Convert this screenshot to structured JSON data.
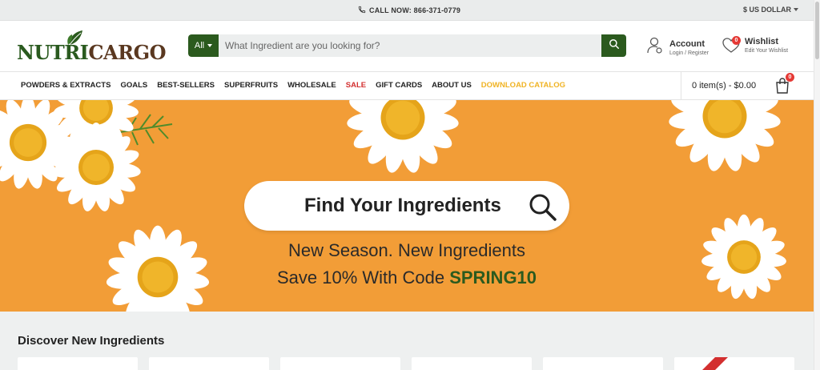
{
  "topbar": {
    "call_label": "CALL NOW: 866-371-0779",
    "currency_label": "$ US DOLLAR"
  },
  "header": {
    "logo_part1": "NUTRI",
    "logo_part2": "CARGO",
    "search": {
      "category": "All",
      "placeholder": "What Ingredient are you looking for?"
    },
    "account": {
      "title": "Account",
      "sub": "Login / Register"
    },
    "wishlist": {
      "title": "Wishlist",
      "sub": "Edit Your Wishlist",
      "count": "0"
    }
  },
  "nav": {
    "items": [
      {
        "label": "POWDERS & EXTRACTS"
      },
      {
        "label": "GOALS"
      },
      {
        "label": "BEST-SELLERS"
      },
      {
        "label": "SUPERFRUITS"
      },
      {
        "label": "WHOLESALE"
      },
      {
        "label": "SALE"
      },
      {
        "label": "GIFT CARDS"
      },
      {
        "label": "ABOUT US"
      },
      {
        "label": "DOWNLOAD CATALOG"
      }
    ],
    "cart_label": "0 item(s) - $0.00",
    "cart_count": "0"
  },
  "hero": {
    "find_label": "Find Your Ingredients",
    "line1": "New Season. New Ingredients",
    "line2_prefix": "Save 10% With Code ",
    "line2_code": "SPRING10"
  },
  "discover": {
    "title": "Discover New Ingredients"
  },
  "colors": {
    "brand_green": "#2b5a1e",
    "hero_orange": "#f29d37",
    "sale_red": "#d32f2f",
    "catalog_yellow": "#f0b323"
  }
}
